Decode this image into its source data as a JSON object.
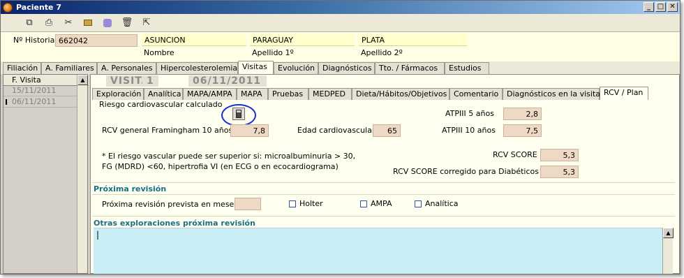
{
  "window": {
    "title": "Paciente 7",
    "btn_min": "_",
    "btn_max": "□",
    "btn_close": "✕"
  },
  "toolbar": {
    "icons": [
      "copy-icon",
      "print-icon",
      "tools-icon",
      "folder-icon",
      "puzzle-icon",
      "trash-icon",
      "export-icon"
    ]
  },
  "patient": {
    "historia_label": "Nº Historia",
    "historia_value": "662042",
    "nombre_value": "ASUNCION",
    "nombre_label": "Nombre",
    "apellido1_value": "PARAGUAY",
    "apellido1_label": "Apellido 1º",
    "apellido2_value": "PLATA",
    "apellido2_label": "Apellido 2º"
  },
  "main_tabs": [
    "Filiación",
    "A. Familiares",
    "A. Personales",
    "Hipercolesterolemia",
    "Visitas",
    "Evolución",
    "Diagnósticos",
    "Tto. / Fármacos",
    "Estudios"
  ],
  "active_main_tab": "Visitas",
  "visits": {
    "header": "F. Visita",
    "rows": [
      "15/11/2011",
      "06/11/2011"
    ]
  },
  "visita": {
    "label": "VISITA",
    "number": "1",
    "date": "06/11/2011"
  },
  "sub_tabs": [
    "Exploración",
    "Analítica",
    "MAPA/AMPA",
    "MAPA",
    "Pruebas",
    "MEDPED",
    "Dieta/Hábitos/Objetivos",
    "Comentario",
    "Diagnósticos en la visita",
    "RCV / Plan"
  ],
  "active_sub_tab": "RCV / Plan",
  "rcv": {
    "section_title": "Riesgo cardiovascular calculado",
    "framingham_label": "RCV general Framingham 10 años",
    "framingham_value": "7,8",
    "edad_label": "Edad cardiovascular",
    "edad_value": "65",
    "atp5_label": "ATPIII 5 años",
    "atp5_value": "2,8",
    "atp10_label": "ATPIII 10 años",
    "atp10_value": "7,5",
    "note_line1": "* El riesgo vascular puede ser superior si: microalbuminuria > 30,",
    "note_line2": "FG (MDRD) <60, hipertrofia VI (en ECG  o en ecocardiograma)",
    "score_label": "RCV SCORE",
    "score_value": "5,3",
    "score_diab_label": "RCV SCORE corregido para Diabéticos",
    "score_diab_value": "5,3"
  },
  "proxima": {
    "section_title": "Próxima revisión",
    "meses_label": "Próxima revisión prevista en meses",
    "meses_value": "",
    "holter_label": "Holter",
    "ampa_label": "AMPA",
    "analitica_label": "Analítica"
  },
  "otras": {
    "section_title": "Otras exploraciones próxima revisión",
    "text": ""
  },
  "colors": {
    "value_bg": "#eed9c4",
    "panel_bg": "#fffff0",
    "section_title": "#1a6e8c",
    "textarea_bg": "#c9eef5",
    "highlight_circle": "#1c2fd0"
  }
}
